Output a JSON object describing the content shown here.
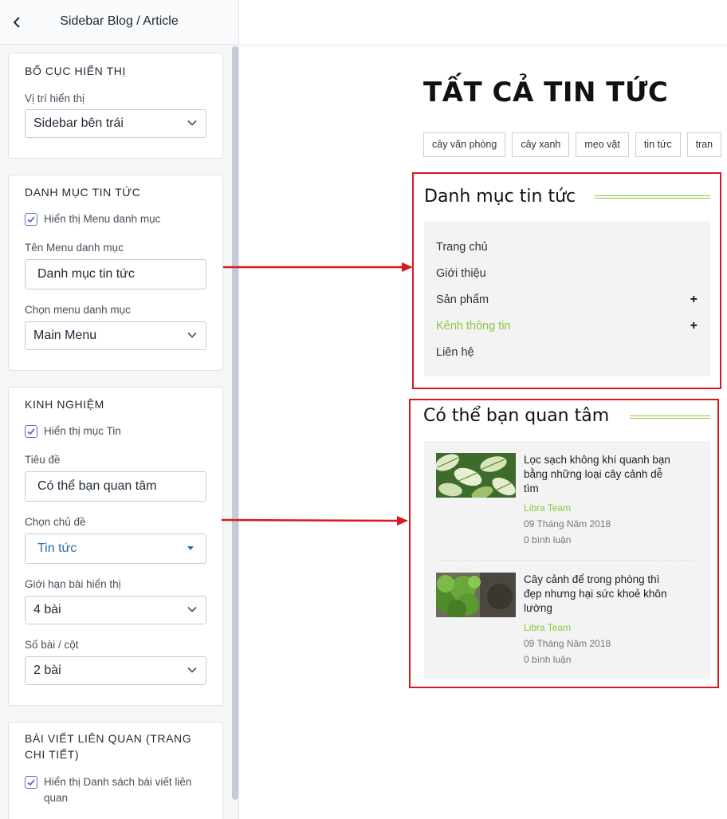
{
  "panel": {
    "title": "Sidebar Blog / Article",
    "layout_section": {
      "title": "BỐ CỤC HIỂN THỊ",
      "position_label": "Vị trí hiển thị",
      "position_value": "Sidebar bên trái"
    },
    "category_section": {
      "title": "DANH MỤC TIN TỨC",
      "show_menu_label": "Hiển thị Menu danh mục",
      "show_menu_checked": true,
      "menu_name_label": "Tên Menu danh mục",
      "menu_name_value": "Danh mục tin tức",
      "choose_menu_label": "Chọn menu danh mục",
      "choose_menu_value": "Main Menu"
    },
    "experience_section": {
      "title": "KINH NGHIỆM",
      "show_items_label": "Hiển thị mục Tin",
      "show_items_checked": true,
      "heading_label": "Tiêu đề",
      "heading_value": "Có thể bạn quan tâm",
      "topic_label": "Chọn chủ đề",
      "topic_value": "Tin tức",
      "limit_label": "Giới hạn bài hiển thị",
      "limit_value": "4 bài",
      "columns_label": "Số bài / cột",
      "columns_value": "2 bài"
    },
    "related_section": {
      "title_line1": "BÀI VIẾT LIÊN QUAN (TRANG",
      "title_line2": "CHI TIẾT)",
      "show_related_line1": "Hiển thị Danh sách bài viết liên",
      "show_related_line2": "quan",
      "show_related_checked": true
    }
  },
  "preview": {
    "page_heading": "TẤT CẢ TIN TỨC",
    "tags": [
      "cây văn phòng",
      "cây xanh",
      "mẹo vặt",
      "tin tức",
      "tran"
    ],
    "category_widget": {
      "title": "Danh mục tin tức",
      "items": [
        {
          "label": "Trang chủ",
          "expandable": false,
          "active": false
        },
        {
          "label": "Giới thiệu",
          "expandable": false,
          "active": false
        },
        {
          "label": "Sản phẩm",
          "expandable": true,
          "active": false
        },
        {
          "label": "Kênh thông tin",
          "expandable": true,
          "active": true
        },
        {
          "label": "Liên hệ",
          "expandable": false,
          "active": false
        }
      ],
      "expand_symbol": "+"
    },
    "posts_widget": {
      "title": "Có thể bạn quan tâm",
      "posts": [
        {
          "title_line1": "Lọc sạch không khí quanh bạn",
          "title_line2": "bằng những loại cây cảnh dễ",
          "title_line3": "tìm",
          "author": "Libra Team",
          "date": "09 Tháng Năm 2018",
          "comments": "0 bình luận"
        },
        {
          "title_line1": "Cây cảnh để trong phòng thì",
          "title_line2": "đẹp nhưng hại sức khoẻ khôn",
          "title_line3": "lường",
          "author": "Libra Team",
          "date": "09 Tháng Năm 2018",
          "comments": "0 bình luận"
        }
      ]
    }
  },
  "colors": {
    "accent_green": "#8cc63e",
    "annotation_red": "#d71920",
    "checkbox_blue": "#5c6ac4",
    "link_blue": "#2b6fa8"
  }
}
